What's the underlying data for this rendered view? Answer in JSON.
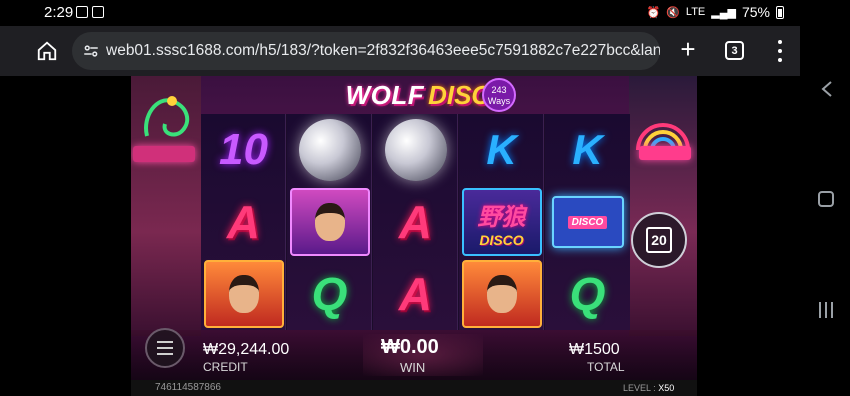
{
  "status_bar": {
    "time": "2:29",
    "network": "LTE",
    "battery": "75%"
  },
  "browser": {
    "url": "web01.sssc1688.com/h5/183/?token=2f832f36463eee5c7591882c7e227bcc&lan",
    "tab_count": "3",
    "new_tab_label": "+"
  },
  "game": {
    "logo": {
      "word1": "WOLF",
      "word2": "DISCO",
      "ways": "243",
      "ways_label": "Ways"
    },
    "reels": [
      [
        "10",
        "A",
        "portrait-man"
      ],
      [
        "disco-ball",
        "portrait-woman",
        "Q"
      ],
      [
        "disco-ball",
        "A",
        "A"
      ],
      [
        "K",
        "wild",
        "portrait-man"
      ],
      [
        "K",
        "cassette",
        "Q"
      ]
    ],
    "wild_text": {
      "cn": "野狼",
      "word": "DISCO"
    },
    "cassette_text": "DISCO",
    "auto_spin_count": "20",
    "credit": {
      "value": "₩29,244.00",
      "label": "CREDIT"
    },
    "win": {
      "value": "₩0.00",
      "label": "WIN"
    },
    "total": {
      "value": "₩1500",
      "label": "TOTAL"
    },
    "footer": {
      "session_id": "746114587866",
      "level_label": "LEVEL :",
      "level_value": "X50"
    }
  },
  "colors": {
    "accent_pink": "#ff3a7a",
    "accent_yellow": "#ffd23a",
    "accent_blue": "#2ab0ff",
    "accent_green": "#3ae07a"
  }
}
